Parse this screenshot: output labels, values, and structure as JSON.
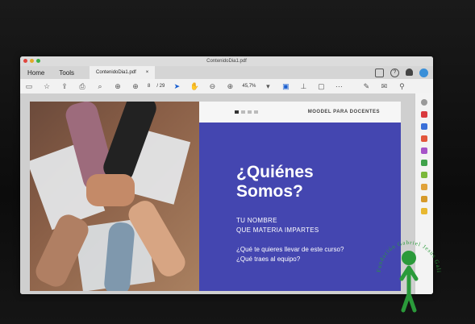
{
  "window": {
    "title": "ContenidoDia1.pdf"
  },
  "menu": {
    "home": "Home",
    "tools": "Tools"
  },
  "doc_tab": {
    "label": "ContenidoDia1.pdf",
    "close": "×"
  },
  "toolbar": {
    "page_current": "8",
    "page_total": "/ 29",
    "zoom": "45,7%"
  },
  "slide": {
    "header": "MOODEL PARA DOCENTES",
    "title_line1": "¿Quiénes",
    "title_line2": "Somos?",
    "name_line": "TU NOMBRE",
    "subject_line": "QUE MATERIA IMPARTES",
    "question1": "¿Qué te quieres llevar de este curso?",
    "question2": "¿Qué traes al equipo?"
  },
  "colors": {
    "slide_blue": "#4446b0",
    "accent_green": "#2a9a3a"
  },
  "watermark": {
    "text": "Fundación Gabriel Jesús Galindo"
  }
}
